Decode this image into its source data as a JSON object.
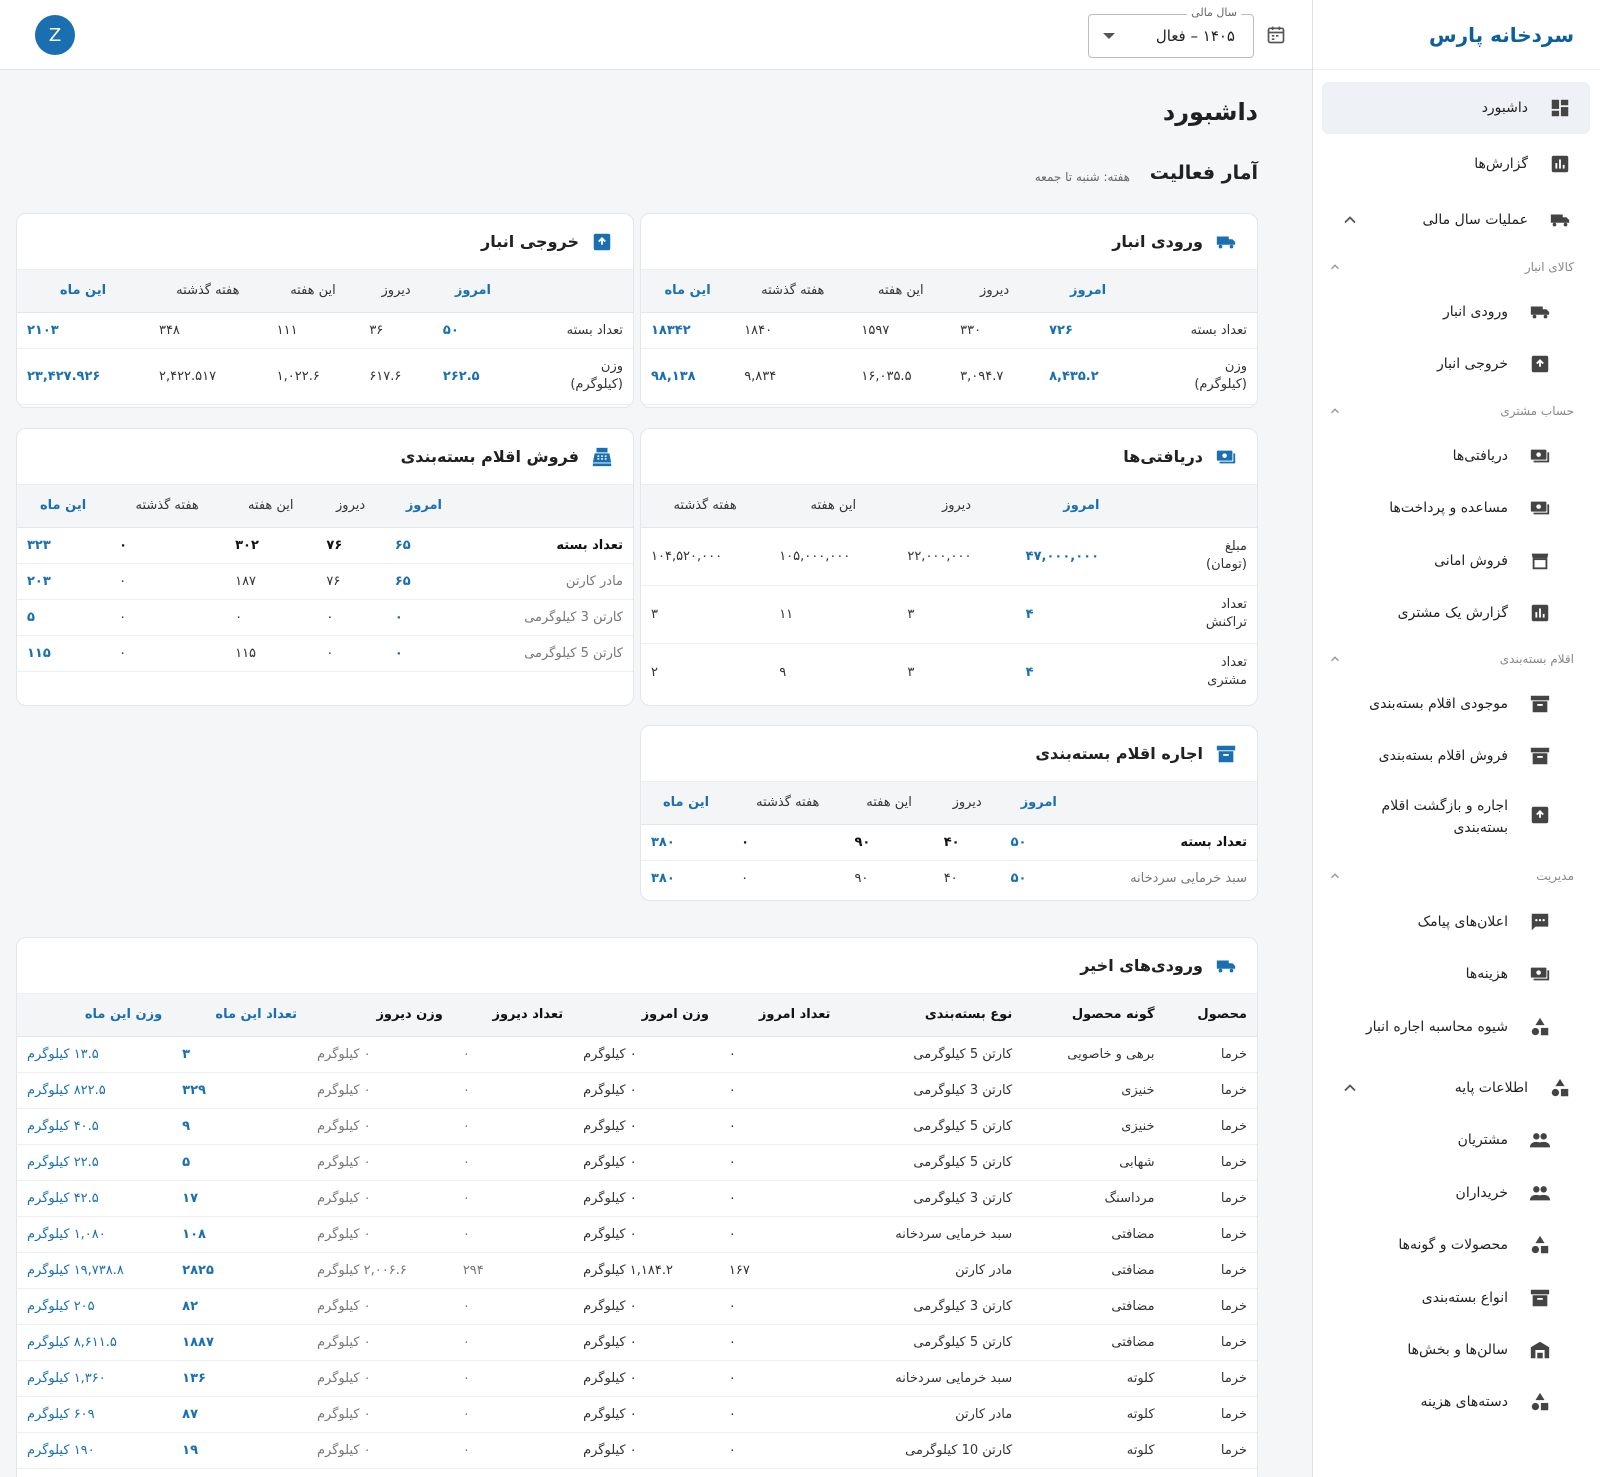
{
  "app": {
    "brand": "سردخانه پارس",
    "avatar_letter": "Z",
    "accent": "#1a6fb0"
  },
  "fiscal_year": {
    "legend": "سال مالی",
    "value": "۱۴۰۵ – فعال"
  },
  "page": {
    "title": "داشبورد",
    "section_title": "آمار فعالیت",
    "section_sub": "هفته: شنبه تا جمعه"
  },
  "sidebar": {
    "dashboard": "داشبورد",
    "reports": "گزارش‌ها",
    "fiscal_ops": "عملیات سال مالی",
    "sec_goods": "کالای انبار",
    "wh_in": "ورودی انبار",
    "wh_out": "خروجی انبار",
    "sec_customer": "حساب مشتری",
    "receipts": "دریافتی‌ها",
    "aid": "مساعده و پرداخت‌ها",
    "consign": "فروش امانی",
    "customer_report": "گزارش یک مشتری",
    "sec_pack": "اقلام بسته‌بندی",
    "pack_stock": "موجودی اقلام بسته‌بندی",
    "pack_sale": "فروش اقلام بسته‌بندی",
    "pack_rent_l1": "اجاره و بازگشت اقلام",
    "pack_rent_l2": "بسته‌بندی",
    "sec_admin": "مدیریت",
    "sms": "اعلان‌های پیامک",
    "costs": "هزینه‌ها",
    "rent_calc": "شیوه محاسبه اجاره انبار",
    "base_info": "اطلاعات پایه",
    "customers": "مشتریان",
    "buyers": "خریداران",
    "products": "محصولات و گونه‌ها",
    "pack_types": "انواع بسته‌بندی",
    "halls": "سالن‌ها و بخش‌ها",
    "cost_categories": "دسته‌های هزینه"
  },
  "periods": {
    "today": "امروز",
    "yesterday": "دیروز",
    "this_week": "این هفته",
    "last_week": "هفته گذشته",
    "this_month": "این ماه"
  },
  "inbound": {
    "title": "ورودی انبار",
    "count_label": "تعداد بسته",
    "weight_label_1": "وزن",
    "weight_label_2": "(کیلوگرم)",
    "count": [
      "۷۲۶",
      "۳۳۰",
      "۱۵۹۷",
      "۱۸۴۰",
      "۱۸۳۴۲"
    ],
    "weight": [
      "۸,۴۳۵.۲",
      "۳,۰۹۴.۷",
      "۱۶,۰۳۵.۵",
      "۹,۸۳۴",
      "۹۸,۱۳۸"
    ]
  },
  "outbound": {
    "title": "خروجی انبار",
    "count_label": "تعداد بسته",
    "weight_label_1": "وزن",
    "weight_label_2": "(کیلوگرم)",
    "count": [
      "۵۰",
      "۳۶",
      "۱۱۱",
      "۳۴۸",
      "۲۱۰۳"
    ],
    "weight": [
      "۲۶۲.۵",
      "۶۱۷.۶",
      "۱,۰۲۲.۶",
      "۲,۴۲۲.۵۱۷",
      "۲۳,۴۲۷.۹۲۶"
    ]
  },
  "receipts": {
    "title": "دریافتی‌ها",
    "rows": [
      {
        "l1": "مبلغ",
        "l2": "(تومان)",
        "v": [
          "۴۷,۰۰۰,۰۰۰",
          "۲۲,۰۰۰,۰۰۰",
          "۱۰۵,۰۰۰,۰۰۰",
          "۱۰۴,۵۲۰,۰۰۰"
        ]
      },
      {
        "l1": "تعداد",
        "l2": "تراکنش",
        "v": [
          "۴",
          "۳",
          "۱۱",
          "۳"
        ]
      },
      {
        "l1": "تعداد",
        "l2": "مشتری",
        "v": [
          "۴",
          "۳",
          "۹",
          "۲"
        ]
      }
    ]
  },
  "pack_sales": {
    "title": "فروش اقلام بسته‌بندی",
    "rows": [
      {
        "label": "تعداد بسته",
        "v": [
          "۶۵",
          "۷۶",
          "۳۰۲",
          "۰",
          "۳۲۳"
        ]
      },
      {
        "label": "مادر کارتن",
        "v": [
          "۶۵",
          "۷۶",
          "۱۸۷",
          "۰",
          "۲۰۳"
        ]
      },
      {
        "label": "کارتن 3 کیلوگرمی",
        "v": [
          "۰",
          "۰",
          "۰",
          "۰",
          "۵"
        ]
      },
      {
        "label": "کارتن 5 کیلوگرمی",
        "v": [
          "۰",
          "۰",
          "۱۱۵",
          "۰",
          "۱۱۵"
        ]
      }
    ]
  },
  "pack_rent": {
    "title": "اجاره اقلام بسته‌بندی",
    "rows": [
      {
        "label": "تعداد بسته",
        "v": [
          "۵۰",
          "۴۰",
          "۹۰",
          "۰",
          "۳۸۰"
        ]
      },
      {
        "label": "سبد خرمایی سردخانه",
        "v": [
          "۵۰",
          "۴۰",
          "۹۰",
          "۰",
          "۳۸۰"
        ]
      }
    ]
  },
  "recent": {
    "title": "ورودی‌های اخیر",
    "headers": [
      "محصول",
      "گونه محصول",
      "نوع بسته‌بندی",
      "تعداد امروز",
      "وزن امروز",
      "تعداد دیروز",
      "وزن دیروز",
      "تعداد این ماه",
      "وزن این ماه"
    ],
    "rows": [
      [
        "خرما",
        "برهی و خاصویی",
        "کارتن 5 کیلوگرمی",
        "۰",
        "۰ کیلوگرم",
        "۰",
        "۰ کیلوگرم",
        "۳",
        "۱۳.۵ کیلوگرم"
      ],
      [
        "خرما",
        "خنیزی",
        "کارتن 3 کیلوگرمی",
        "۰",
        "۰ کیلوگرم",
        "۰",
        "۰ کیلوگرم",
        "۳۲۹",
        "۸۲۲.۵ کیلوگرم"
      ],
      [
        "خرما",
        "خنیزی",
        "کارتن 5 کیلوگرمی",
        "۰",
        "۰ کیلوگرم",
        "۰",
        "۰ کیلوگرم",
        "۹",
        "۴۰.۵ کیلوگرم"
      ],
      [
        "خرما",
        "شهابی",
        "کارتن 5 کیلوگرمی",
        "۰",
        "۰ کیلوگرم",
        "۰",
        "۰ کیلوگرم",
        "۵",
        "۲۲.۵ کیلوگرم"
      ],
      [
        "خرما",
        "مرداسنگ",
        "کارتن 3 کیلوگرمی",
        "۰",
        "۰ کیلوگرم",
        "۰",
        "۰ کیلوگرم",
        "۱۷",
        "۴۲.۵ کیلوگرم"
      ],
      [
        "خرما",
        "مضافتی",
        "سبد خرمایی سردخانه",
        "۰",
        "۰ کیلوگرم",
        "۰",
        "۰ کیلوگرم",
        "۱۰۸",
        "۱,۰۸۰ کیلوگرم"
      ],
      [
        "خرما",
        "مضافتی",
        "مادر کارتن",
        "۱۶۷",
        "۱,۱۸۴.۲ کیلوگرم",
        "۲۹۴",
        "۲,۰۰۶.۶ کیلوگرم",
        "۲۸۲۵",
        "۱۹,۷۳۸.۸ کیلوگرم"
      ],
      [
        "خرما",
        "مضافتی",
        "کارتن 3 کیلوگرمی",
        "۰",
        "۰ کیلوگرم",
        "۰",
        "۰ کیلوگرم",
        "۸۲",
        "۲۰۵ کیلوگرم"
      ],
      [
        "خرما",
        "مضافتی",
        "کارتن 5 کیلوگرمی",
        "۰",
        "۰ کیلوگرم",
        "۰",
        "۰ کیلوگرم",
        "۱۸۸۷",
        "۸,۶۱۱.۵ کیلوگرم"
      ],
      [
        "خرما",
        "کلوته",
        "سبد خرمایی سردخانه",
        "۰",
        "۰ کیلوگرم",
        "۰",
        "۰ کیلوگرم",
        "۱۳۶",
        "۱,۳۶۰ کیلوگرم"
      ],
      [
        "خرما",
        "کلوته",
        "مادر کارتن",
        "۰",
        "۰ کیلوگرم",
        "۰",
        "۰ کیلوگرم",
        "۸۷",
        "۶۰۹ کیلوگرم"
      ],
      [
        "خرما",
        "کلوته",
        "کارتن 10 کیلوگرمی",
        "۰",
        "۰ کیلوگرم",
        "۰",
        "۰ کیلوگرم",
        "۱۹",
        "۱۹۰ کیلوگرم"
      ]
    ]
  }
}
